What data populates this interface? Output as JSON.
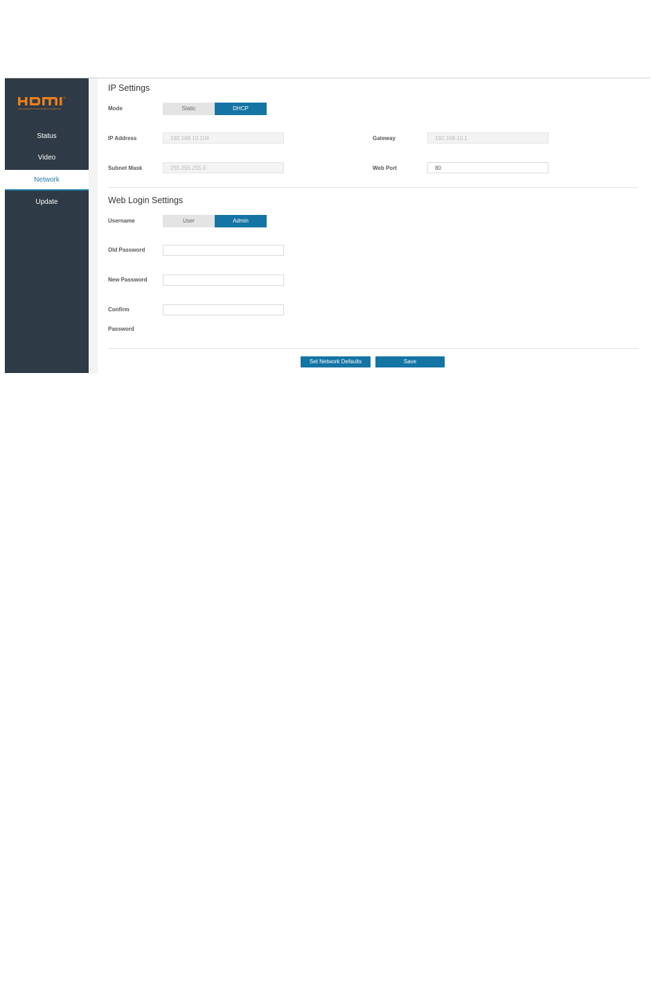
{
  "brand": {
    "logo_text": "HDMI",
    "logo_tagline": "HIGH-DEFINITION MULTIMEDIA INTERFACE",
    "logo_color": "#e8801e"
  },
  "sidebar": {
    "items": [
      {
        "label": "Status",
        "active": false
      },
      {
        "label": "Video",
        "active": false
      },
      {
        "label": "Network",
        "active": true
      },
      {
        "label": "Update",
        "active": false
      }
    ],
    "bg_color": "#2e3a45",
    "accent_color": "#1a7aa8"
  },
  "ip_settings": {
    "title": "IP Settings",
    "mode_label": "Mode",
    "mode_options": [
      "Static",
      "DHCP"
    ],
    "mode_selected": "DHCP",
    "ip_address_label": "IP Address",
    "ip_address_value": "192.168.10.104",
    "gateway_label": "Gateway",
    "gateway_value": "192.168.10.1",
    "subnet_mask_label": "Subnet Mask",
    "subnet_mask_value": "255.255.255.0",
    "web_port_label": "Web Port",
    "web_port_value": "80"
  },
  "web_login": {
    "title": "Web Login Settings",
    "username_label": "Username",
    "username_options": [
      "User",
      "Admin"
    ],
    "username_selected": "Admin",
    "old_password_label": "Old Password",
    "new_password_label": "New Password",
    "confirm_label_line1": "Confirm",
    "confirm_label_line2": "Password"
  },
  "actions": {
    "set_defaults_label": "Set Network Defaults",
    "save_label": "Save",
    "button_color": "#1474a4"
  }
}
